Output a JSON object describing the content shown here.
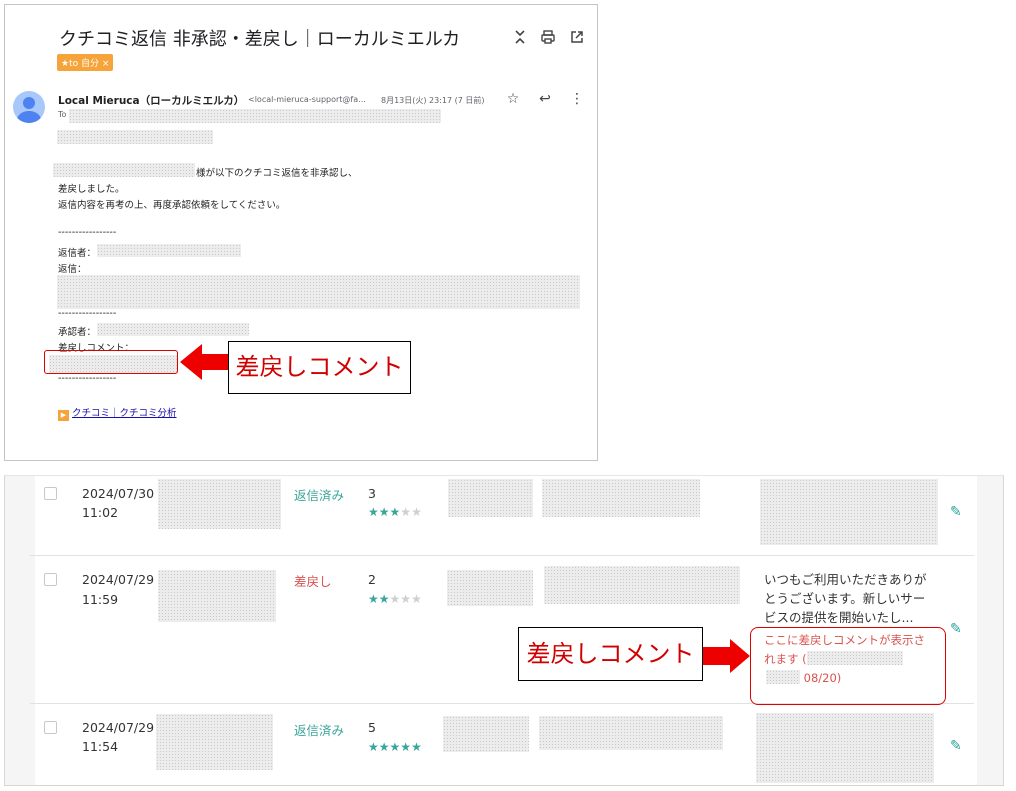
{
  "email": {
    "subject": "クチコミ返信 非承認・差戻し｜ローカルミエルカ",
    "label_chip": "★to 自分 ×",
    "sender_name": "Local Mieruca（ローカルミエルカ）",
    "sender_email": "<local-mieruca-support@fa...",
    "date": "8月13日(火) 23:17 (7 日前)",
    "to_label": "To",
    "body_suffix_1": "様が以下のクチコミ返信を非承認し、",
    "body_line_2": "差戻しました。",
    "body_line_3": "返信内容を再考の上、再度承認依頼をしてください。",
    "divider": "-----------------",
    "replier_label": "返信者：",
    "reply_label": "返信：",
    "approver_label": "承認者：",
    "rejection_comment_label": "差戻しコメント：",
    "footer_link": "クチコミ｜クチコミ分析",
    "icons": [
      "expand-icon",
      "print-icon",
      "open-new-window-icon",
      "star-icon",
      "reply-icon",
      "more-vert-icon"
    ]
  },
  "callouts": {
    "email_callout": "差戻しコメント",
    "table_callout": "差戻しコメント"
  },
  "table": {
    "rows": [
      {
        "date": "2024/07/30",
        "time": "11:02",
        "status": "返信済み",
        "rating": "3",
        "stars_filled": 3
      },
      {
        "date": "2024/07/29",
        "time": "11:59",
        "status": "差戻し",
        "rating": "2",
        "stars_filled": 2,
        "reply_text": "いつもご利用いただきありがとうございます。新しいサービスの提供を開始いたし...",
        "rejection_comment_1": "ここに差戻しコメントが表示されます (",
        "rejection_comment_2": "08/20)"
      },
      {
        "date": "2024/07/29",
        "time": "11:54",
        "status": "返信済み",
        "rating": "5",
        "stars_filled": 5
      }
    ]
  },
  "colors": {
    "accent_teal": "#3aa59a",
    "rejected_red": "#d9534f",
    "callout_red": "#e00000",
    "chip_orange": "#f6a43a"
  }
}
